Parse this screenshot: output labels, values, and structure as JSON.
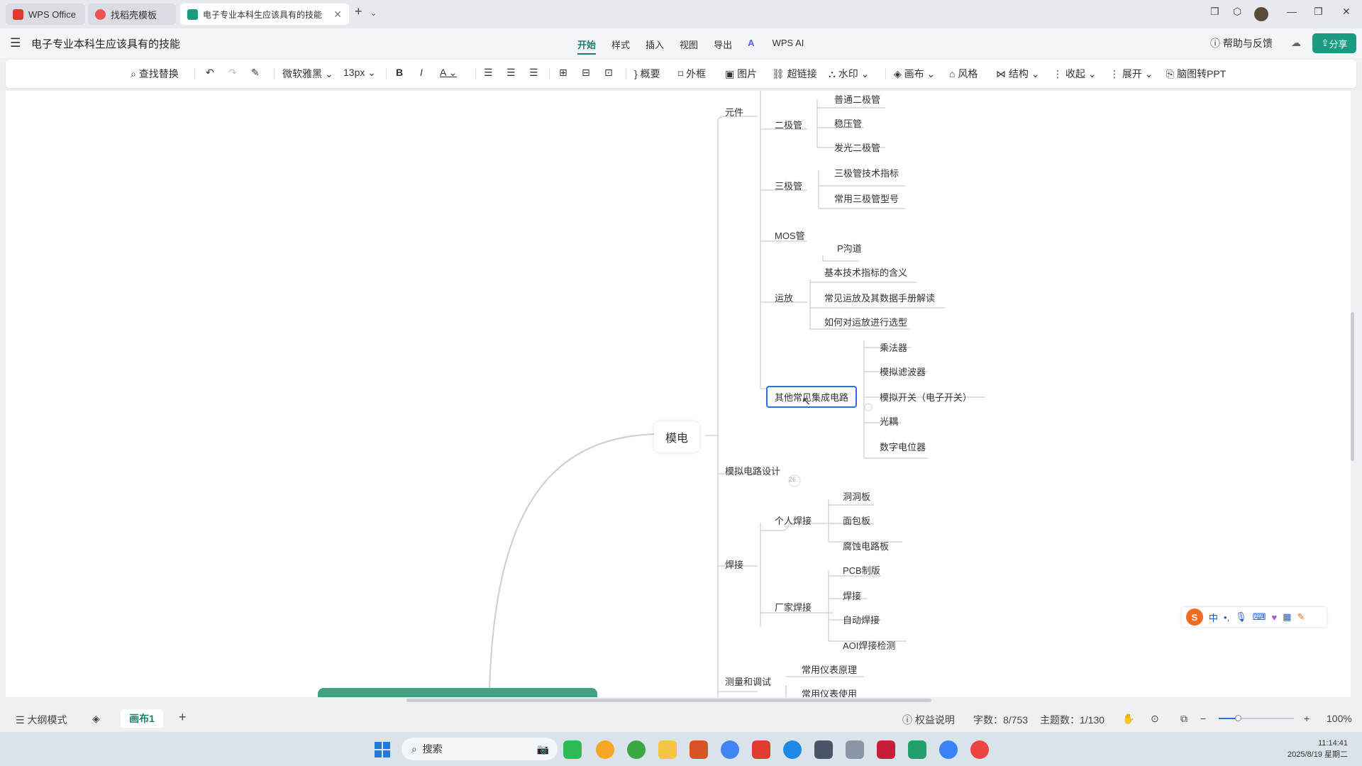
{
  "tabs": [
    {
      "label": "WPS Office",
      "icon": "wps-logo-icon"
    },
    {
      "label": "找稻壳模板",
      "icon": "docer-icon"
    },
    {
      "label": "电子专业本科生应该具有的技能",
      "icon": "mindmap-icon"
    }
  ],
  "header": {
    "title": "电子专业本科生应该具有的技能",
    "menu": [
      "开始",
      "样式",
      "插入",
      "视图",
      "导出",
      "WPS AI"
    ],
    "active_menu": "开始",
    "help": "帮助与反馈",
    "share": "分享"
  },
  "toolbar": {
    "find_replace": "查找替换",
    "font": "微软雅黑",
    "font_size": "13px",
    "summary": "概要",
    "frame": "外框",
    "image": "图片",
    "hyperlink": "超链接",
    "watermark": "水印",
    "canvas": "画布",
    "style": "风格",
    "structure": "结构",
    "collapse": "收起",
    "expand": "展开",
    "to_ppt": "脑图转PPT"
  },
  "mindmap": {
    "root": "模电",
    "level1": [
      "元件",
      "模拟电路设计",
      "焊接",
      "测量和调试"
    ],
    "components": {
      "diode": "二极管",
      "diode_children": [
        "普通二极管",
        "稳压管",
        "发光二极管"
      ],
      "triode": "三极管",
      "triode_children": [
        "三极管技术指标",
        "常用三极管型号"
      ],
      "mos": "MOS管",
      "mos_children": [
        "P沟道"
      ],
      "opamp": "运放",
      "opamp_children": [
        "基本技术指标的含义",
        "常见运放及其数据手册解读",
        "如何对运放进行选型"
      ],
      "other_ic": "其他常见集成电路",
      "other_ic_children": [
        "乘法器",
        "模拟滤波器",
        "模拟开关（电子开关）",
        "光耦",
        "数字电位器"
      ]
    },
    "analog_count": "26",
    "welding": {
      "personal": "个人焊接",
      "personal_children": [
        "洞洞板",
        "面包板",
        "腐蚀电路板"
      ],
      "factory": "厂家焊接",
      "factory_children": [
        "PCB制版",
        "焊接",
        "自动焊接",
        "AOI焊接检测"
      ]
    },
    "measure_children": [
      "常用仪表原理",
      "常用仪表使用"
    ]
  },
  "statusbar": {
    "outline": "大纲模式",
    "canvas_tab": "画布1",
    "rights": "权益说明",
    "word_count": "字数：8/753",
    "topic_count": "主题数：1/130",
    "zoom": "100%"
  },
  "taskbar": {
    "search": "搜索",
    "time": "11:14:41",
    "date": "2025/8/19 星期二"
  },
  "ime": {
    "lang": "中"
  }
}
